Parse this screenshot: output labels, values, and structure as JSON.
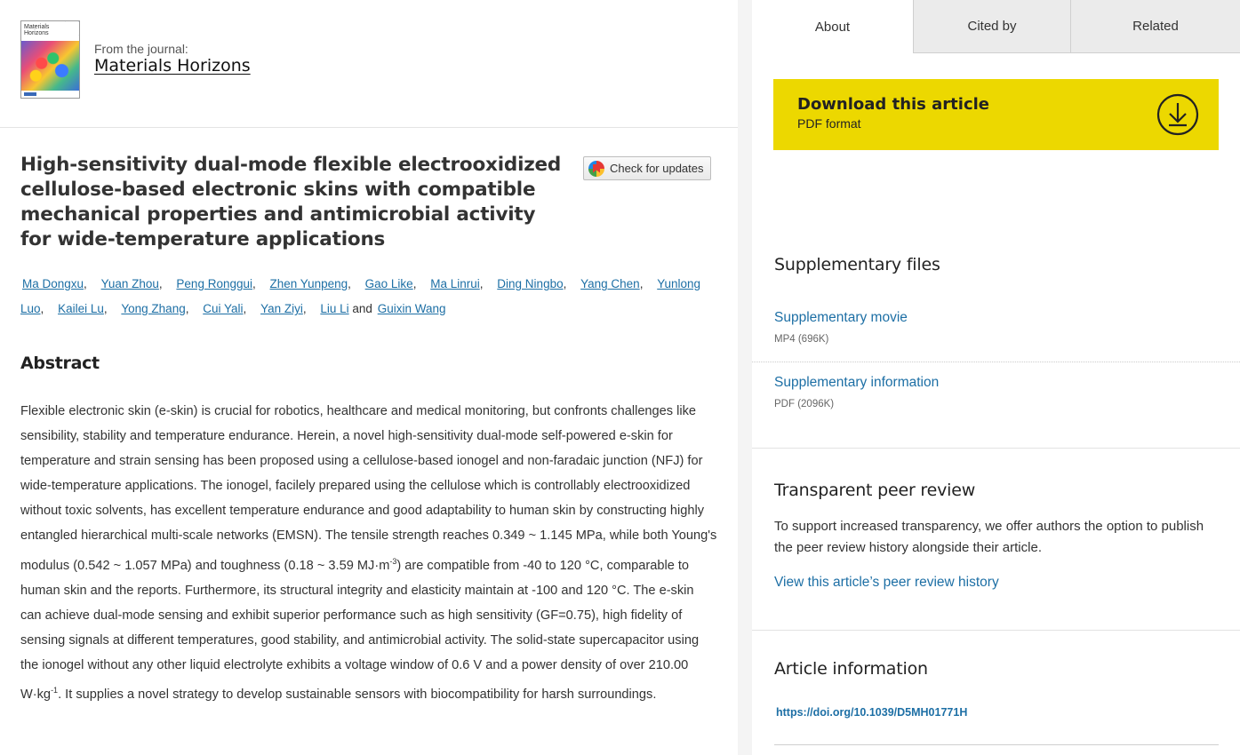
{
  "journal": {
    "cover_title": "Materials Horizons",
    "from_label": "From the journal:",
    "name": "Materials Horizons"
  },
  "article": {
    "title": "High-sensitivity dual-mode flexible electrooxidized cellulose-based electronic skins with compatible mechanical properties and antimicrobial activity for wide-temperature applications",
    "check_updates_label": "Check for updates",
    "authors": [
      "Ma Dongxu",
      "Yuan Zhou",
      "Peng Ronggui",
      "Zhen Yunpeng",
      "Gao Like",
      "Ma Linrui",
      "Ding Ningbo",
      "Yang Chen",
      "Yunlong Luo",
      "Kailei Lu",
      "Yong Zhang",
      "Cui Yali",
      "Yan Ziyi",
      "Liu Li",
      "Guixin Wang"
    ],
    "authors_and": "and",
    "abstract_heading": "Abstract",
    "abstract_parts": [
      "Flexible electronic skin (e-skin) is crucial for robotics, healthcare and medical monitoring, but confronts challenges like sensibility, stability and temperature endurance. Herein, a novel high-sensitivity dual-mode self-powered e-skin for temperature and strain sensing has been proposed using a cellulose-based ionogel and non-faradaic junction (NFJ) for wide-temperature applications. The ionogel, facilely prepared using the cellulose which is controllably electrooxidized without toxic solvents, has excellent temperature endurance and good adaptability to human skin by constructing highly entangled hierarchical multi-scale networks (EMSN). The tensile strength reaches 0.349 ~ 1.145 MPa, while both Young's modulus (0.542 ~ 1.057 MPa) and toughness (0.18 ~ 3.59 MJ·m",
      "-3",
      ") are compatible from -40 to 120 °C, comparable to human skin and the reports. Furthermore, its structural integrity and elasticity maintain at -100 and 120 °C. The e-skin can achieve dual-mode sensing and exhibit superior performance such as high sensitivity (GF=0.75), high fidelity of sensing signals at different temperatures, good stability, and antimicrobial activity. The solid-state supercapacitor using the ionogel without any other liquid electrolyte exhibits a voltage window of 0.6 V and a power density of over 210.00 W·kg",
      "-1",
      ". It supplies a novel strategy to develop sustainable sensors with biocompatibility for harsh surroundings."
    ]
  },
  "sidebar": {
    "tabs": [
      "About",
      "Cited by",
      "Related"
    ],
    "download": {
      "title": "Download this article",
      "format": "PDF format"
    },
    "supplementary": {
      "heading": "Supplementary files",
      "files": [
        {
          "label": "Supplementary movie",
          "meta": "MP4 (696K)"
        },
        {
          "label": "Supplementary information",
          "meta": "PDF (2096K)"
        }
      ]
    },
    "peer_review": {
      "heading": "Transparent peer review",
      "text": "To support increased transparency, we offer authors the option to publish the peer review history alongside their article.",
      "link": "View this article’s peer review history"
    },
    "article_info": {
      "heading": "Article information",
      "doi": "https://doi.org/10.1039/D5MH01771H"
    }
  },
  "colors": {
    "accent_link": "#1d6fa5",
    "download_bg": "#ecd800"
  }
}
